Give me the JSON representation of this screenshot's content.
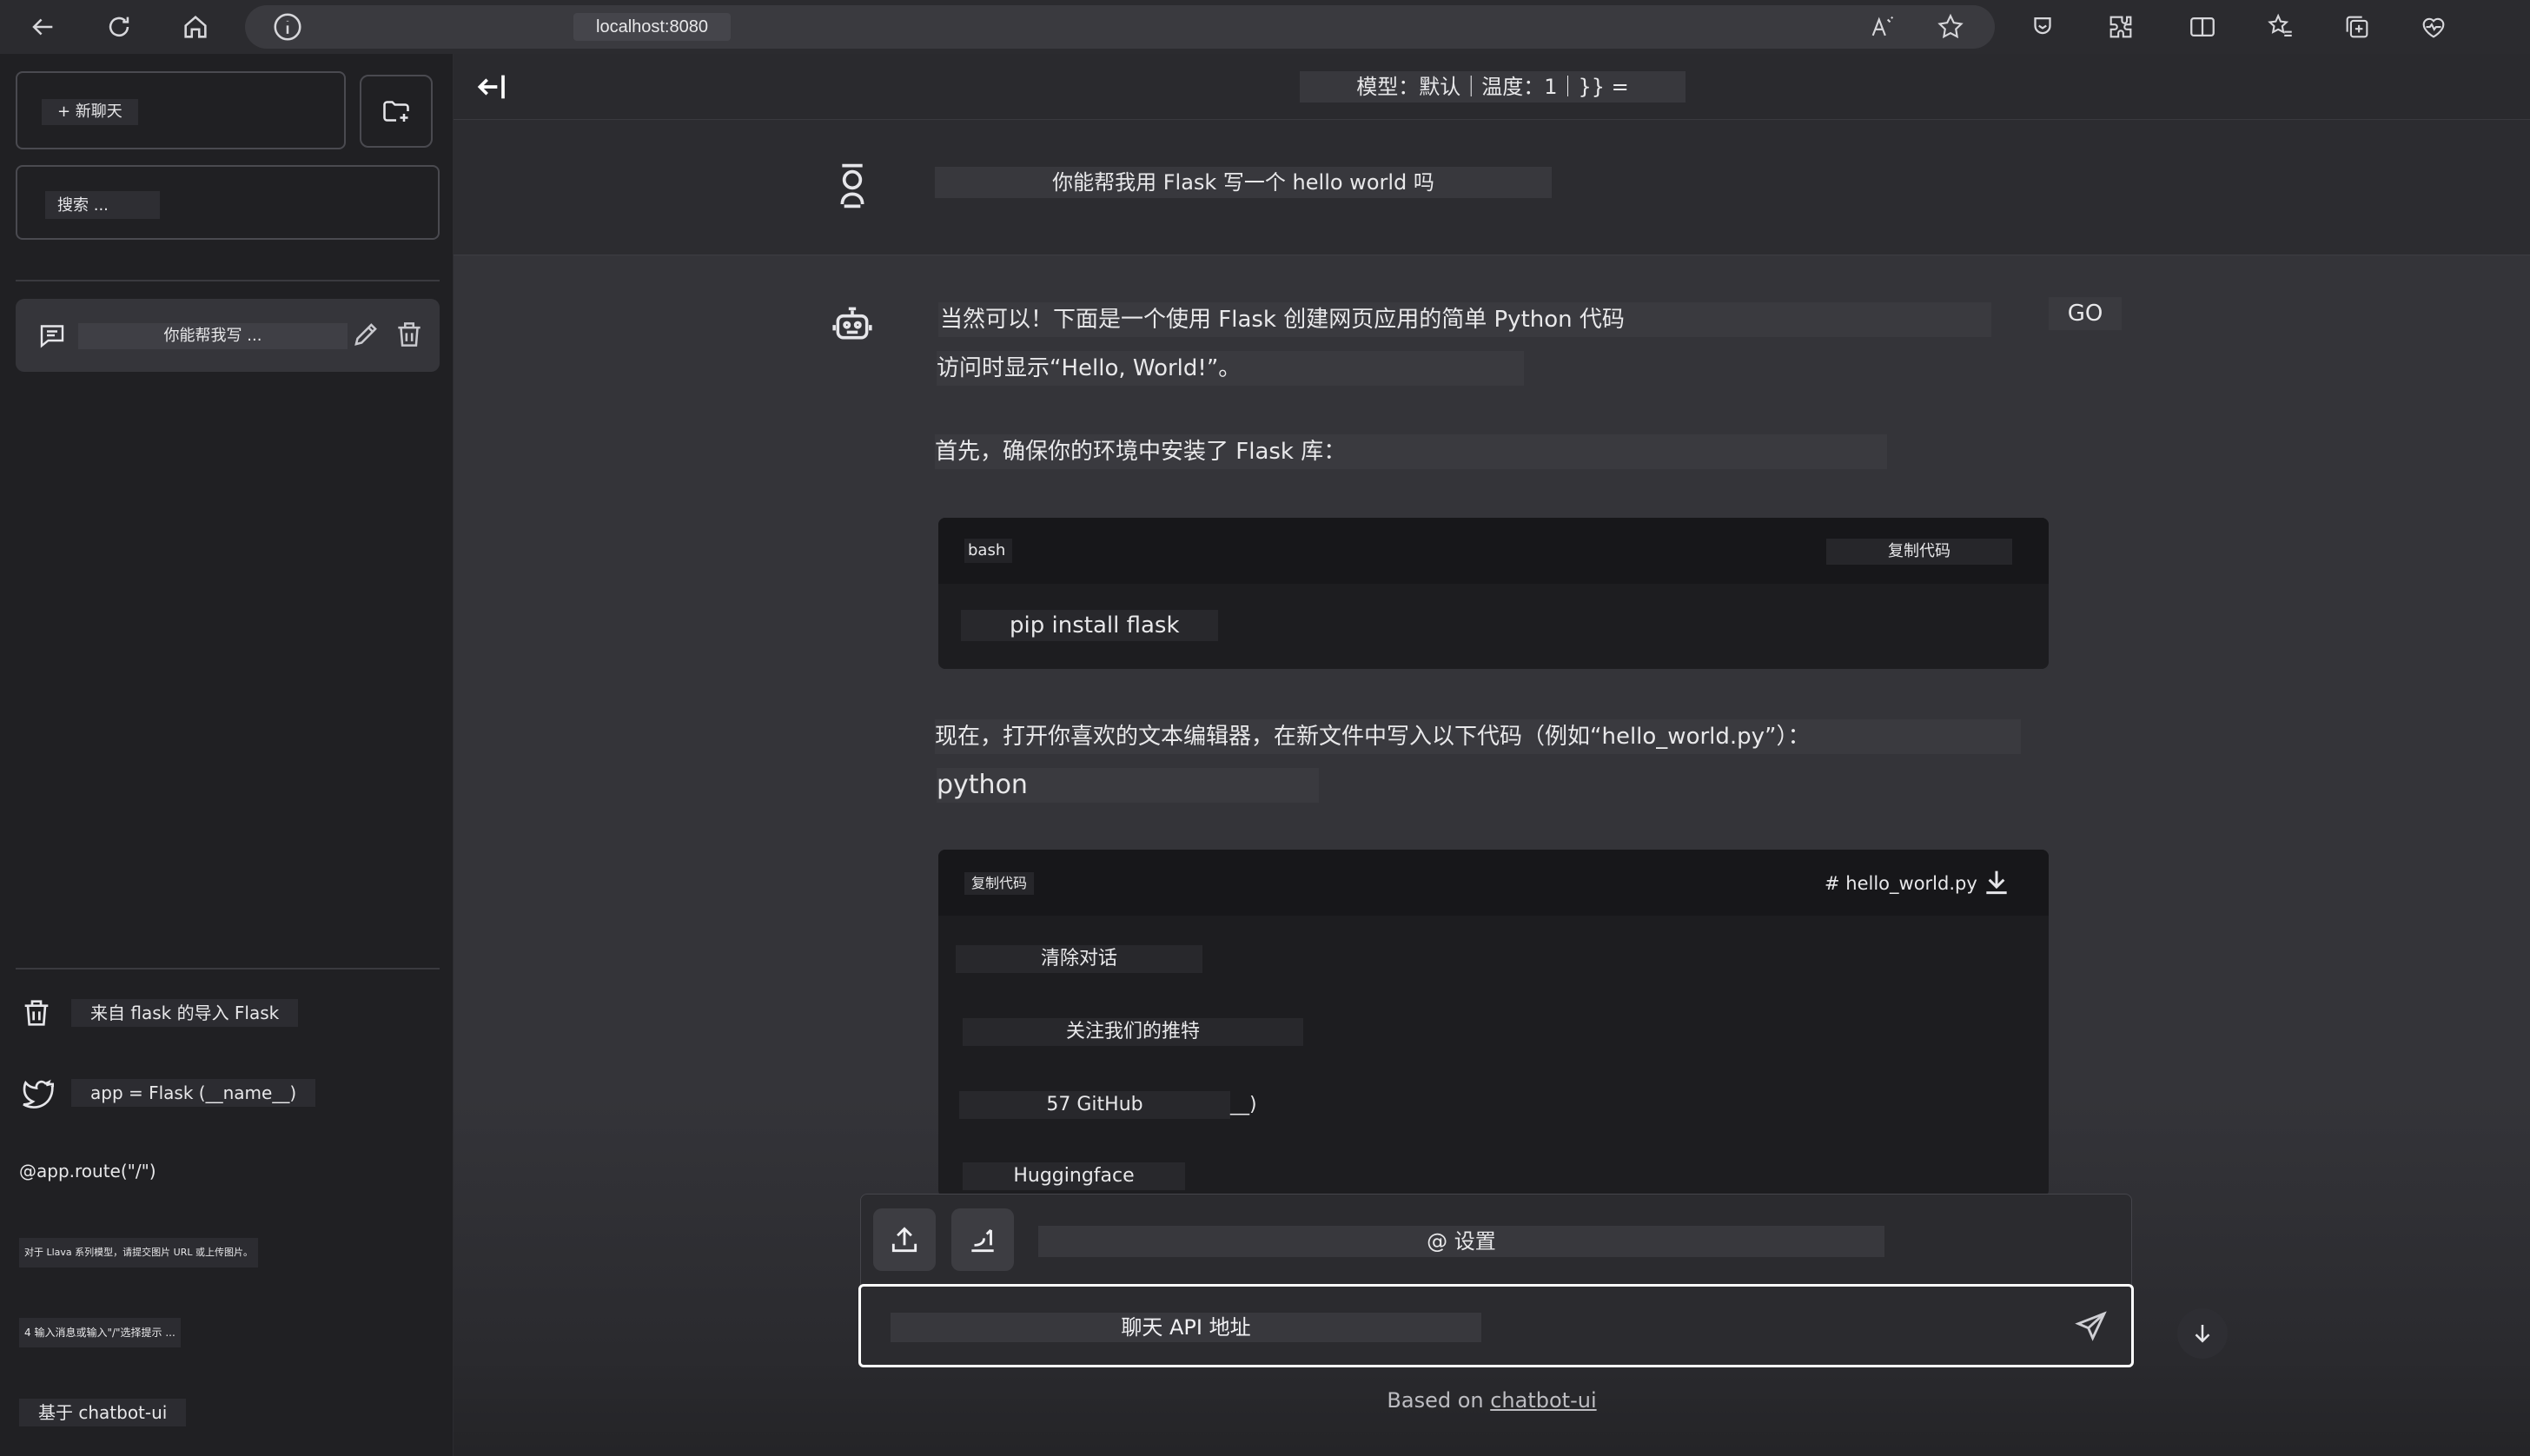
{
  "browser": {
    "url": "localhost:8080",
    "icons": [
      "back-icon",
      "refresh-icon",
      "home-icon",
      "info-icon",
      "read-aloud-icon",
      "favorite-icon",
      "sidebar-icon",
      "extensions-icon",
      "split-screen-icon",
      "favorites-list-icon",
      "collections-icon",
      "health-icon"
    ]
  },
  "sidebar": {
    "new_chat": "+ 新聊天",
    "search_placeholder": "搜索 ...",
    "conversations": [
      {
        "title": "你能帮我写 ..."
      }
    ],
    "footer": {
      "clear": "来自 flask 的导入 Flask",
      "twitter": "app = Flask (__name__)",
      "route": "@app.route(\"/\")",
      "llava_note": "对于 Llava 系列模型，请提交图片 URL 或上传图片。",
      "prompt_hint": "4 输入消息或输入\"/\"选择提示 ...",
      "based_on": "基于 chatbot-ui"
    }
  },
  "header": {
    "model_info": "模型：默认｜温度：1｜}} ="
  },
  "messages": {
    "user": "你能帮我用 Flask 写一个 hello world 吗",
    "bot": {
      "p1": "当然可以！下面是一个使用 Flask 创建网页应用的简单 Python 代码",
      "p2": "访问时显示“Hello, World!”。",
      "p3": "首先，确保你的环境中安装了 Flask 库：",
      "p4": "现在，打开你喜欢的文本编辑器，在新文件中写入以下代码（例如“hello_world.py”）：",
      "p5": "python",
      "go": "GO"
    },
    "code1": {
      "lang": "bash",
      "copy": "复制代码",
      "line": "pip install flask"
    },
    "code2": {
      "copy": "复制代码",
      "file": "# hello_world.py",
      "lines": [
        "清除对话",
        "关注我们的推特",
        "57 GitHub",
        "__)",
        "Huggingface"
      ]
    }
  },
  "input": {
    "settings": "@ 设置",
    "placeholder": "聊天 API 地址"
  },
  "footer": {
    "prefix": "Based on ",
    "link": "chatbot-ui"
  }
}
